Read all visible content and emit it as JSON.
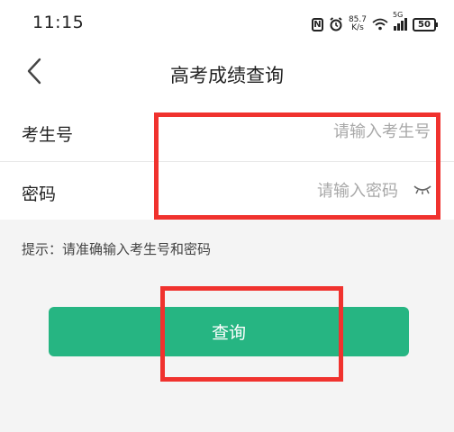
{
  "status_bar": {
    "time": "11:15",
    "net_speed_value": "85.7",
    "net_speed_unit": "K/s",
    "network_type": "5G",
    "battery": "50"
  },
  "nav": {
    "title": "高考成绩查询",
    "back_icon": "chevron-left-icon"
  },
  "form": {
    "exam_number": {
      "label": "考生号",
      "placeholder": "请输入考生号",
      "value": ""
    },
    "password": {
      "label": "密码",
      "placeholder": "请输入密码",
      "value": "",
      "visibility_icon": "eye-closed-icon"
    }
  },
  "hint": "提示：请准确输入考生号和密码",
  "query_button": {
    "label": "查询",
    "color": "#26b582"
  },
  "annotation_color": "#f0322e"
}
